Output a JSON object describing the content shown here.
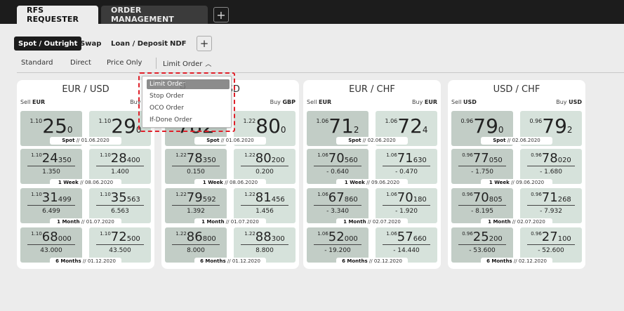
{
  "tabs": [
    {
      "label": "RFS REQUESTER",
      "active": true
    },
    {
      "label": "ORDER MANAGEMENT",
      "active": false
    }
  ],
  "tab_add": "+",
  "subtabs": [
    "Spot / Outright",
    "Swap",
    "Loan / Deposit",
    "NDF"
  ],
  "subtab_add": "+",
  "order_types": [
    "Standard",
    "Direct",
    "Price Only",
    "Limit Order"
  ],
  "limit_dropdown": {
    "items": [
      "Limit Order",
      "Stop Order",
      "OCO Order",
      "If-Done Order"
    ],
    "selected": "Limit Order"
  },
  "cards": [
    {
      "title": "EUR / USD",
      "sell_label": "Sell",
      "sell_ccy": "EUR",
      "buy_label": "Buy",
      "buy_ccy": "EU",
      "spot": {
        "sell": {
          "pre": "1.10",
          "mid": "25",
          "suf": "0"
        },
        "buy": {
          "pre": "1.10",
          "mid": "29",
          "suf": "0"
        },
        "tenor": "Spot",
        "date": "01.06.2020"
      },
      "rows": [
        {
          "sell": {
            "pre": "1.10",
            "mid": "24",
            "suf": "350",
            "pts": "1.350"
          },
          "buy": {
            "pre": "1.10",
            "mid": "28",
            "suf": "400",
            "pts": "1.400"
          },
          "tenor": "1 Week",
          "date": "08.06.2020"
        },
        {
          "sell": {
            "pre": "1.10",
            "mid": "31",
            "suf": "499",
            "pts": "6.499"
          },
          "buy": {
            "pre": "1.10",
            "mid": "35",
            "suf": "563",
            "pts": "6.563"
          },
          "tenor": "1 Month",
          "date": "01.07.2020"
        },
        {
          "sell": {
            "pre": "1.10",
            "mid": "68",
            "suf": "000",
            "pts": "43.000"
          },
          "buy": {
            "pre": "1.10",
            "mid": "72",
            "suf": "500",
            "pts": "43.500"
          },
          "tenor": "6 Months",
          "date": "01.12.2020"
        }
      ]
    },
    {
      "title": "USD",
      "sell_label": "",
      "sell_ccy": "",
      "buy_label": "Buy",
      "buy_ccy": "GBP",
      "spot": {
        "sell": {
          "pre": "",
          "mid": "782",
          "suf": ""
        },
        "buy": {
          "pre": "1.22",
          "mid": "80",
          "suf": "0"
        },
        "tenor": "Spot",
        "date": "01.06.2020"
      },
      "rows": [
        {
          "sell": {
            "pre": "1.22",
            "mid": "78",
            "suf": "350",
            "pts": "0.150"
          },
          "buy": {
            "pre": "1.22",
            "mid": "80",
            "suf": "200",
            "pts": "0.200"
          },
          "tenor": "1 Week",
          "date": "08.06.2020"
        },
        {
          "sell": {
            "pre": "1.22",
            "mid": "79",
            "suf": "592",
            "pts": "1.392"
          },
          "buy": {
            "pre": "1.22",
            "mid": "81",
            "suf": "456",
            "pts": "1.456"
          },
          "tenor": "1 Month",
          "date": "01.07.2020"
        },
        {
          "sell": {
            "pre": "1.22",
            "mid": "86",
            "suf": "800",
            "pts": "8.000"
          },
          "buy": {
            "pre": "1.22",
            "mid": "88",
            "suf": "300",
            "pts": "8.800"
          },
          "tenor": "6 Months",
          "date": "01.12.2020"
        }
      ]
    },
    {
      "title": "EUR / CHF",
      "sell_label": "Sell",
      "sell_ccy": "EUR",
      "buy_label": "Buy",
      "buy_ccy": "EUR",
      "spot": {
        "sell": {
          "pre": "1.06",
          "mid": "71",
          "suf": "2"
        },
        "buy": {
          "pre": "1.06",
          "mid": "72",
          "suf": "4"
        },
        "tenor": "Spot",
        "date": "02.06.2020"
      },
      "rows": [
        {
          "sell": {
            "pre": "1.06",
            "mid": "70",
            "suf": "560",
            "pts": "- 0.640"
          },
          "buy": {
            "pre": "1.06",
            "mid": "71",
            "suf": "630",
            "pts": "- 0.470"
          },
          "tenor": "1 Week",
          "date": "09.06.2020"
        },
        {
          "sell": {
            "pre": "1.06",
            "mid": "67",
            "suf": "860",
            "pts": "- 3.340"
          },
          "buy": {
            "pre": "1.06",
            "mid": "70",
            "suf": "180",
            "pts": "- 1.920"
          },
          "tenor": "1 Month",
          "date": "02.07.2020"
        },
        {
          "sell": {
            "pre": "1.06",
            "mid": "52",
            "suf": "000",
            "pts": "- 19.200"
          },
          "buy": {
            "pre": "1.06",
            "mid": "57",
            "suf": "660",
            "pts": "- 14.440"
          },
          "tenor": "6 Months",
          "date": "02.12.2020"
        }
      ]
    },
    {
      "title": "USD / CHF",
      "sell_label": "Sell",
      "sell_ccy": "USD",
      "buy_label": "Buy",
      "buy_ccy": "USD",
      "spot": {
        "sell": {
          "pre": "0.96",
          "mid": "79",
          "suf": "0"
        },
        "buy": {
          "pre": "0.96",
          "mid": "79",
          "suf": "2"
        },
        "tenor": "Spot",
        "date": "02.06.2020"
      },
      "rows": [
        {
          "sell": {
            "pre": "0.96",
            "mid": "77",
            "suf": "050",
            "pts": "- 1.750"
          },
          "buy": {
            "pre": "0.96",
            "mid": "78",
            "suf": "020",
            "pts": "- 1.680"
          },
          "tenor": "1 Week",
          "date": "09.06.2020"
        },
        {
          "sell": {
            "pre": "0.96",
            "mid": "70",
            "suf": "805",
            "pts": "- 8.195"
          },
          "buy": {
            "pre": "0.96",
            "mid": "71",
            "suf": "268",
            "pts": "- 7.932"
          },
          "tenor": "1 Month",
          "date": "02.07.2020"
        },
        {
          "sell": {
            "pre": "0.96",
            "mid": "25",
            "suf": "200",
            "pts": "- 53.600"
          },
          "buy": {
            "pre": "0.96",
            "mid": "27",
            "suf": "100",
            "pts": "- 52.600"
          },
          "tenor": "6 Months",
          "date": "02.12.2020"
        }
      ]
    }
  ],
  "tenor_separator": "//"
}
